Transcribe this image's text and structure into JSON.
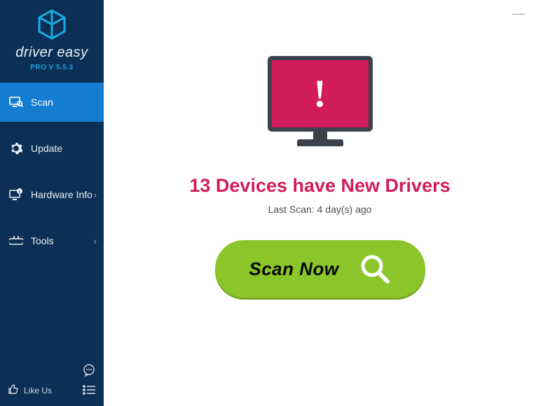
{
  "brand": {
    "name": "driver easy",
    "version_line": "PRO V 5.5.3"
  },
  "nav": {
    "scan": "Scan",
    "update": "Update",
    "hardware_info": "Hardware Info",
    "tools": "Tools"
  },
  "footer": {
    "like_label": "Like Us"
  },
  "status": {
    "headline": "13 Devices have New Drivers",
    "last_scan": "Last Scan: 4 day(s) ago"
  },
  "scan_button": {
    "label": "Scan Now"
  },
  "colors": {
    "sidebar": "#0c2f55",
    "active": "#157dd1",
    "accent_pink": "#d21b5b",
    "scan_green": "#8ac62a"
  }
}
